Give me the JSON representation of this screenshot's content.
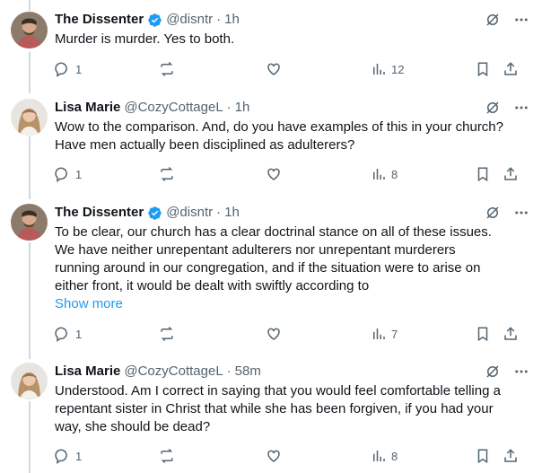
{
  "colors": {
    "text": "#0f1419",
    "secondary": "#536471",
    "link": "#1d9bf0",
    "verified": "#1d9bf0",
    "line": "#cfd9de"
  },
  "tweets": [
    {
      "name": "The Dissenter",
      "verified": true,
      "handle": "@disntr",
      "dot": "·",
      "time": "1h",
      "text": [
        "Murder is murder. Yes to both."
      ],
      "show_more": "",
      "replies": "1",
      "retweets": "",
      "likes": "",
      "views": "12"
    },
    {
      "name": "Lisa Marie",
      "verified": false,
      "handle": "@CozyCottageL",
      "dot": "·",
      "time": "1h",
      "text": [
        "Wow to the comparison. And, do you have examples of this in your church?",
        "Have men actually been disciplined as adulterers?"
      ],
      "show_more": "",
      "replies": "1",
      "retweets": "",
      "likes": "",
      "views": "8"
    },
    {
      "name": "The Dissenter",
      "verified": true,
      "handle": "@disntr",
      "dot": "·",
      "time": "1h",
      "text": [
        "To be clear, our church has a clear doctrinal stance on all of these issues.",
        "We have neither unrepentant adulterers nor unrepentant murderers",
        "running around in our congregation, and if the situation were to arise on",
        "either front, it would be dealt with swiftly according to"
      ],
      "show_more": "Show more",
      "replies": "1",
      "retweets": "",
      "likes": "",
      "views": "7"
    },
    {
      "name": "Lisa Marie",
      "verified": false,
      "handle": "@CozyCottageL",
      "dot": "·",
      "time": "58m",
      "text": [
        "Understood. Am I correct in saying that you would feel comfortable telling a",
        "repentant sister in Christ that while she has been forgiven, if you had your",
        "way, she should be dead?"
      ],
      "show_more": "",
      "replies": "1",
      "retweets": "",
      "likes": "",
      "views": "8"
    }
  ]
}
